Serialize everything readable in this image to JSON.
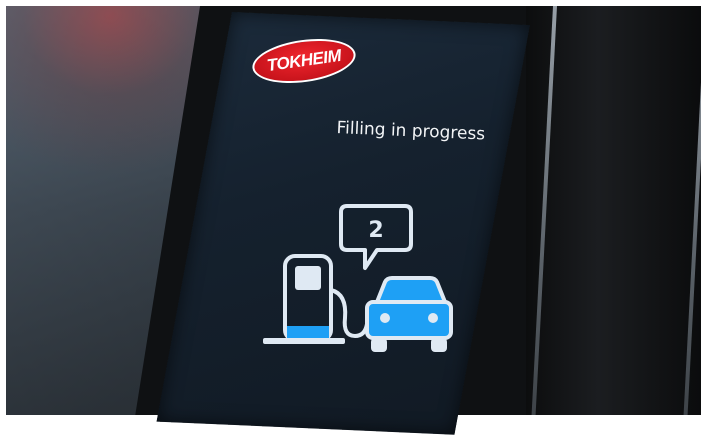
{
  "brand": {
    "name": "TOKHEIM"
  },
  "screen": {
    "status_text": "Filling in progress",
    "pump_number": "2",
    "icon_names": [
      "fuel-pump-icon",
      "car-icon",
      "speech-bubble-icon"
    ]
  },
  "colors": {
    "brand_red": "#d41a22",
    "icon_outline": "#dfe9f3",
    "icon_fill_blue": "#1ea0f5",
    "screen_bg": "#15212e"
  },
  "fuel_level": 0.15
}
